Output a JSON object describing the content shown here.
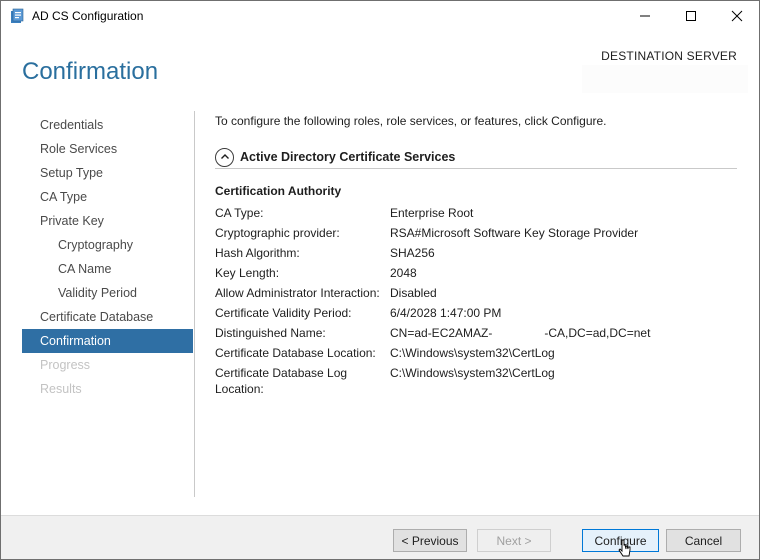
{
  "window": {
    "title": "AD CS Configuration",
    "controls": {
      "minimize": "minimize",
      "maximize": "maximize",
      "close": "close"
    }
  },
  "header": {
    "page_title": "Confirmation",
    "destination_label": "DESTINATION SERVER",
    "destination_value": ""
  },
  "nav": {
    "items": [
      {
        "label": "Credentials",
        "level": 0,
        "state": "normal"
      },
      {
        "label": "Role Services",
        "level": 0,
        "state": "normal"
      },
      {
        "label": "Setup Type",
        "level": 0,
        "state": "normal"
      },
      {
        "label": "CA Type",
        "level": 0,
        "state": "normal"
      },
      {
        "label": "Private Key",
        "level": 0,
        "state": "normal"
      },
      {
        "label": "Cryptography",
        "level": 1,
        "state": "normal"
      },
      {
        "label": "CA Name",
        "level": 1,
        "state": "normal"
      },
      {
        "label": "Validity Period",
        "level": 1,
        "state": "normal"
      },
      {
        "label": "Certificate Database",
        "level": 0,
        "state": "normal"
      },
      {
        "label": "Confirmation",
        "level": 0,
        "state": "active"
      },
      {
        "label": "Progress",
        "level": 0,
        "state": "disabled"
      },
      {
        "label": "Results",
        "level": 0,
        "state": "disabled"
      }
    ]
  },
  "content": {
    "intro": "To configure the following roles, role services, or features, click Configure.",
    "section_title": "Active Directory Certificate Services",
    "group_title": "Certification Authority",
    "properties": [
      {
        "label": "CA Type:",
        "value": "Enterprise Root"
      },
      {
        "label": "Cryptographic provider:",
        "value": "RSA#Microsoft Software Key Storage Provider"
      },
      {
        "label": "Hash Algorithm:",
        "value": "SHA256"
      },
      {
        "label": "Key Length:",
        "value": "2048"
      },
      {
        "label": "Allow Administrator Interaction:",
        "value": "Disabled"
      },
      {
        "label": "Certificate Validity Period:",
        "value": "6/4/2028 1:47:00 PM"
      },
      {
        "label": "Distinguished Name:",
        "value_prefix": "CN=ad-EC2AMAZ-",
        "value_suffix": "-CA,DC=ad,DC=net"
      },
      {
        "label": "Certificate Database Location:",
        "value": "C:\\Windows\\system32\\CertLog"
      },
      {
        "label": "Certificate Database Log Location:",
        "value": "C:\\Windows\\system32\\CertLog"
      }
    ]
  },
  "footer": {
    "previous_label": "< Previous",
    "next_label": "Next >",
    "configure_label": "Configure",
    "cancel_label": "Cancel"
  },
  "colors": {
    "title_blue": "#2a6f9e",
    "active_nav_bg": "#2f6fa4",
    "disabled_text": "#c3c3c3"
  }
}
